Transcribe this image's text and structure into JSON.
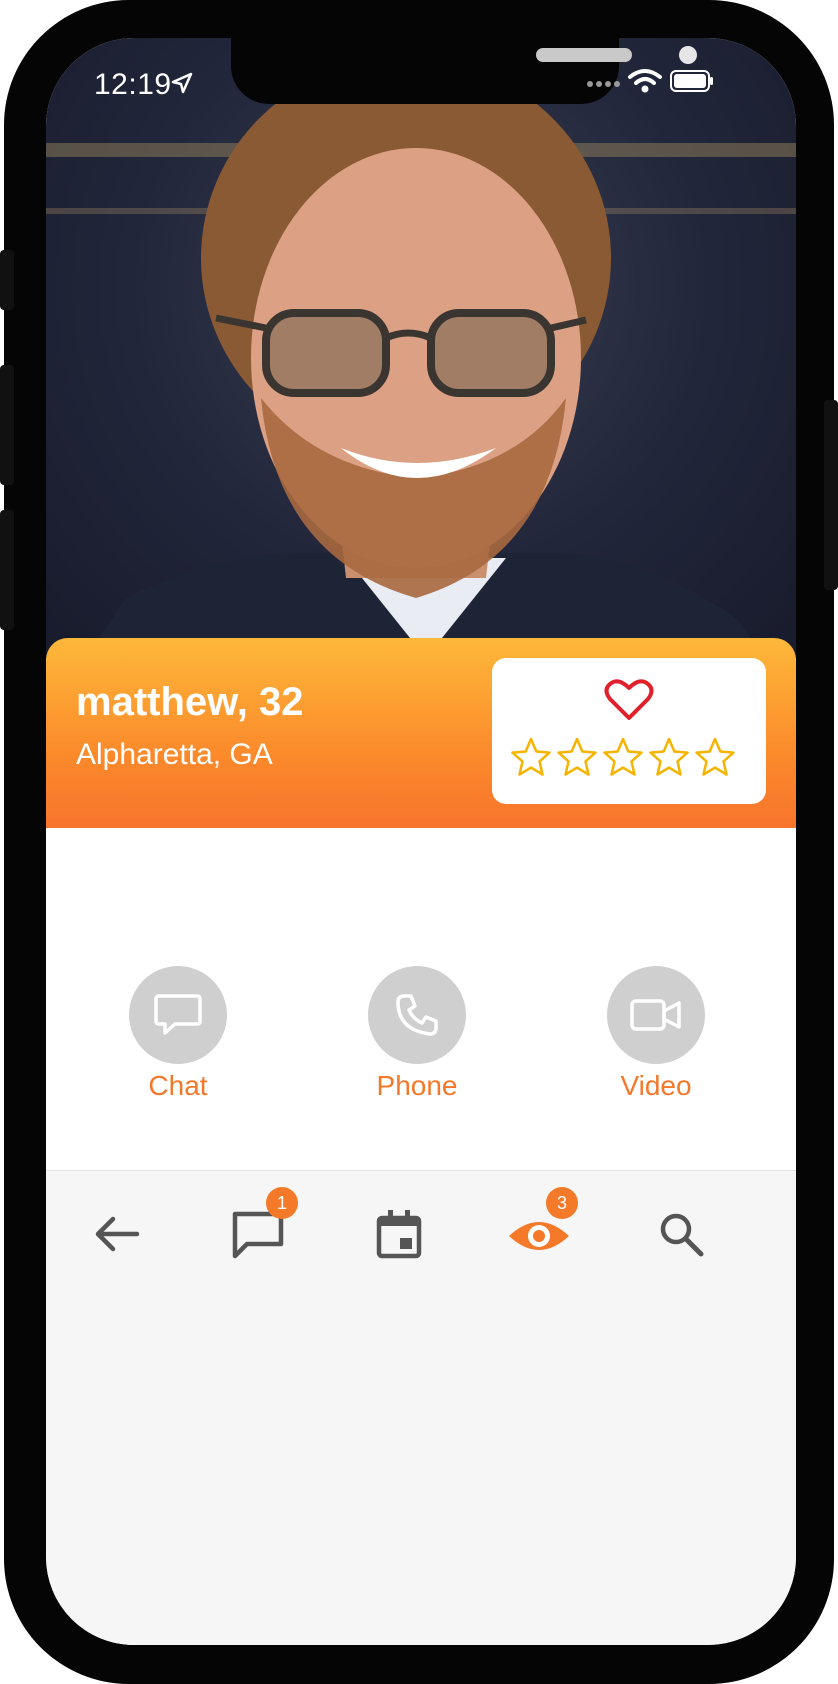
{
  "status_bar": {
    "time": "12:19"
  },
  "profile": {
    "name_age": "matthew, 32",
    "location": "Alpharetta, GA",
    "rating": 0,
    "rating_max": 5
  },
  "actions": [
    {
      "label": "Chat",
      "icon": "chat-bubble-icon"
    },
    {
      "label": "Phone",
      "icon": "phone-icon"
    },
    {
      "label": "Video",
      "icon": "video-camera-icon"
    }
  ],
  "nav": {
    "messages_badge": "1",
    "views_badge": "3"
  },
  "colors": {
    "accent": "#f47a2a",
    "header_top": "#fdb83a",
    "header_bottom": "#f7742c",
    "action_circle": "#cfcfcf",
    "heart": "#e0202a",
    "star": "#f4b400"
  }
}
